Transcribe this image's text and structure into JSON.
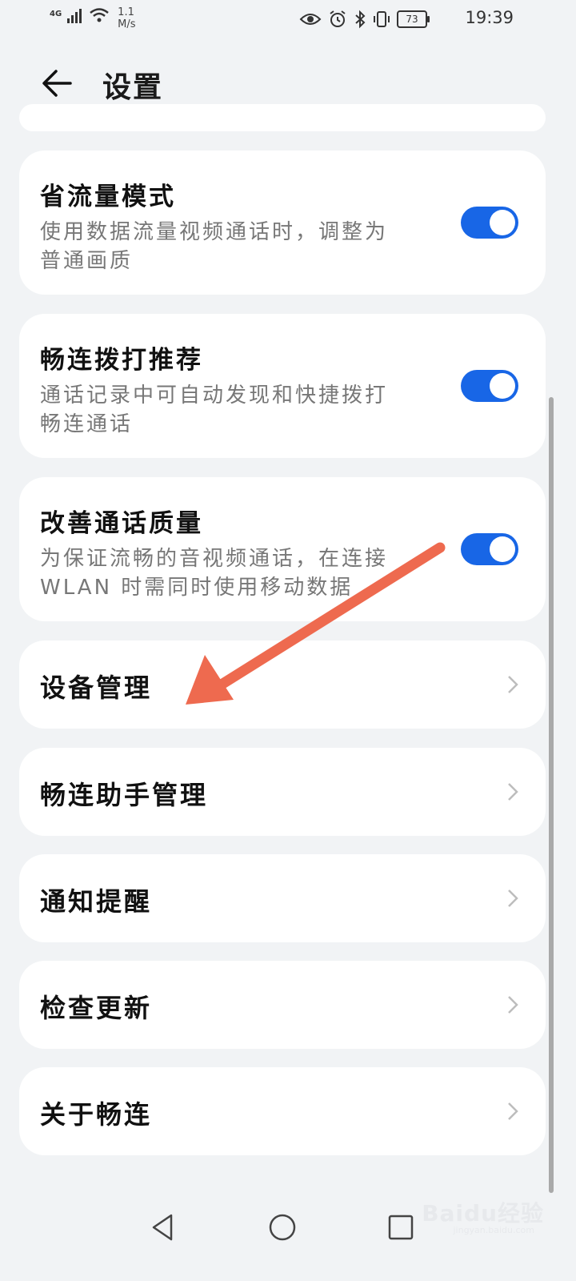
{
  "status_bar": {
    "network": "4G",
    "speed_value": "1.1",
    "speed_unit": "M/s",
    "battery": "73",
    "time": "19:39"
  },
  "header": {
    "title": "设置",
    "back_icon": "back-arrow-icon"
  },
  "settings": {
    "toggles": [
      {
        "title": "省流量模式",
        "line1": "使用数据流量视频通话时，调整为",
        "line2": "普通画质",
        "enabled": true
      },
      {
        "title": "畅连拨打推荐",
        "line1": "通话记录中可自动发现和快捷拨打",
        "line2": "畅连通话",
        "enabled": true
      },
      {
        "title": "改善通话质量",
        "line1": "为保证流畅的音视频通话，在连接",
        "line2": "WLAN 时需同时使用移动数据",
        "enabled": true
      }
    ],
    "nav_items": [
      {
        "label": "设备管理"
      },
      {
        "label": "畅连助手管理"
      },
      {
        "label": "通知提醒"
      },
      {
        "label": "检查更新"
      },
      {
        "label": "关于畅连"
      }
    ]
  },
  "colors": {
    "accent": "#1866e6",
    "annotation_arrow": "#ee6a4f",
    "background": "#f1f3f5"
  },
  "watermark": {
    "text": "Baidu经验",
    "sub": "jingyan.baidu.com"
  }
}
